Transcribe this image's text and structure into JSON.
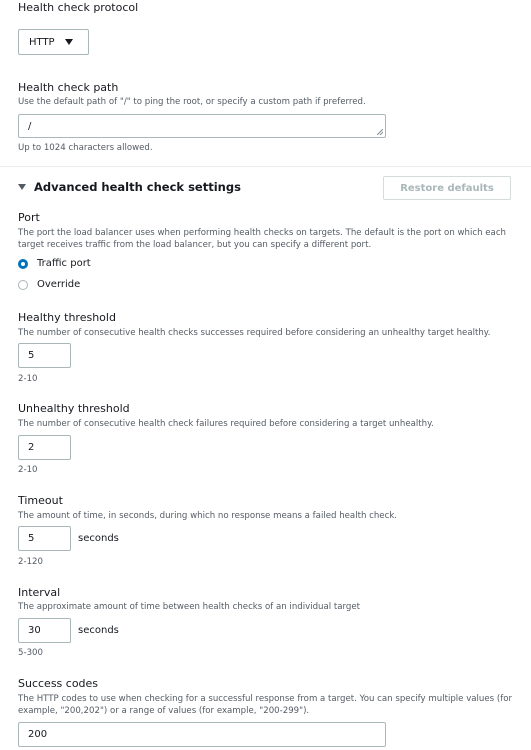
{
  "protocol": {
    "label": "Health check protocol",
    "value": "HTTP"
  },
  "path": {
    "label": "Health check path",
    "description": "Use the default path of \"/\" to ping the root, or specify a custom path if preferred.",
    "value": "/",
    "hint": "Up to 1024 characters allowed."
  },
  "advanced": {
    "title": "Advanced health check settings",
    "restore_label": "Restore defaults"
  },
  "port": {
    "label": "Port",
    "description": "The port the load balancer uses when performing health checks on targets. The default is the port on which each target receives traffic from the load balancer, but you can specify a different port.",
    "options": [
      "Traffic port",
      "Override"
    ],
    "selected": "Traffic port"
  },
  "healthy": {
    "label": "Healthy threshold",
    "description": "The number of consecutive health checks successes required before considering an unhealthy target healthy.",
    "value": "5",
    "hint": "2-10"
  },
  "unhealthy": {
    "label": "Unhealthy threshold",
    "description": "The number of consecutive health check failures required before considering a target unhealthy.",
    "value": "2",
    "hint": "2-10"
  },
  "timeout": {
    "label": "Timeout",
    "description": "The amount of time, in seconds, during which no response means a failed health check.",
    "value": "5",
    "unit": "seconds",
    "hint": "2-120"
  },
  "interval": {
    "label": "Interval",
    "description": "The approximate amount of time between health checks of an individual target",
    "value": "30",
    "unit": "seconds",
    "hint": "5-300"
  },
  "success": {
    "label": "Success codes",
    "description": "The HTTP codes to use when checking for a successful response from a target. You can specify multiple values (for example, \"200,202\") or a range of values (for example, \"200-299\").",
    "value": "200"
  },
  "colors": {
    "accent": "#0073bb",
    "text": "#16191f",
    "muted": "#545b64",
    "border": "#aab7b8"
  }
}
